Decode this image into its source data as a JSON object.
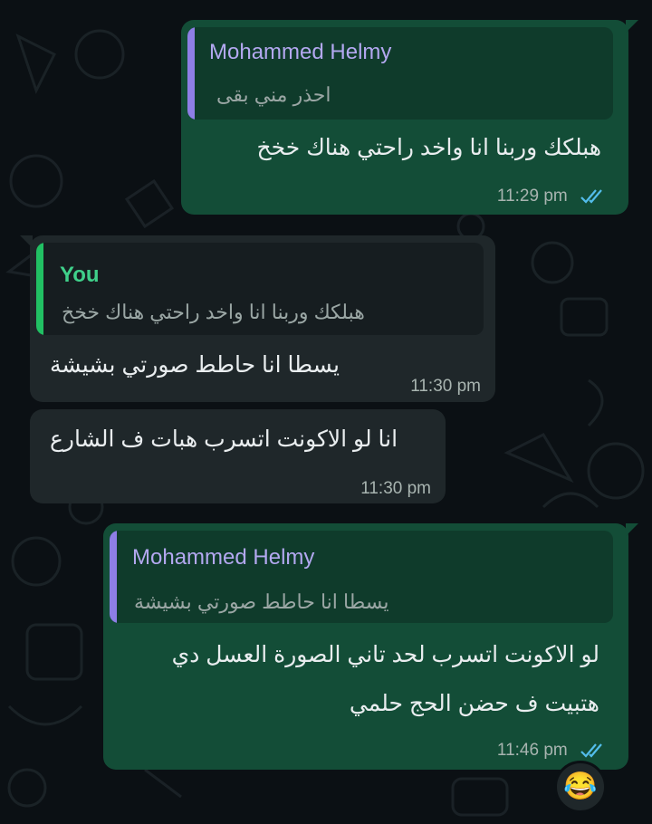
{
  "colors": {
    "background": "#0b1014",
    "outgoing_bubble": "#134d37",
    "incoming_bubble": "#1f272a",
    "quote_bar_other": "#8e7ee6",
    "quote_bar_you": "#21c063",
    "read_ticks": "#53bdeb"
  },
  "messages": [
    {
      "direction": "outgoing",
      "quote": {
        "sender": "Mohammed Helmy",
        "text": "احذر مني بقى"
      },
      "text_lines": [
        "هبلكك وربنا انا واخد راحتي هناك خخخ"
      ],
      "time": "11:29 pm",
      "status_icon": "double-check-read-icon"
    },
    {
      "direction": "incoming",
      "quote": {
        "sender": "You",
        "text": "هبلكك وربنا انا واخد راحتي هناك خخخ"
      },
      "text_lines": [
        "يسطا انا حاطط صورتي بشيشة"
      ],
      "time": "11:30 pm"
    },
    {
      "direction": "incoming",
      "text_lines": [
        "انا لو الاكونت اتسرب هبات ف الشارع"
      ],
      "time": "11:30 pm"
    },
    {
      "direction": "outgoing",
      "quote": {
        "sender": "Mohammed Helmy",
        "text": "يسطا انا حاطط صورتي بشيشة"
      },
      "text_lines": [
        "لو الاكونت اتسرب لحد تاني الصورة العسل دي",
        "هتبيت ف حضن الحج حلمي"
      ],
      "time": "11:46 pm",
      "status_icon": "double-check-read-icon",
      "reaction": "😂"
    }
  ]
}
